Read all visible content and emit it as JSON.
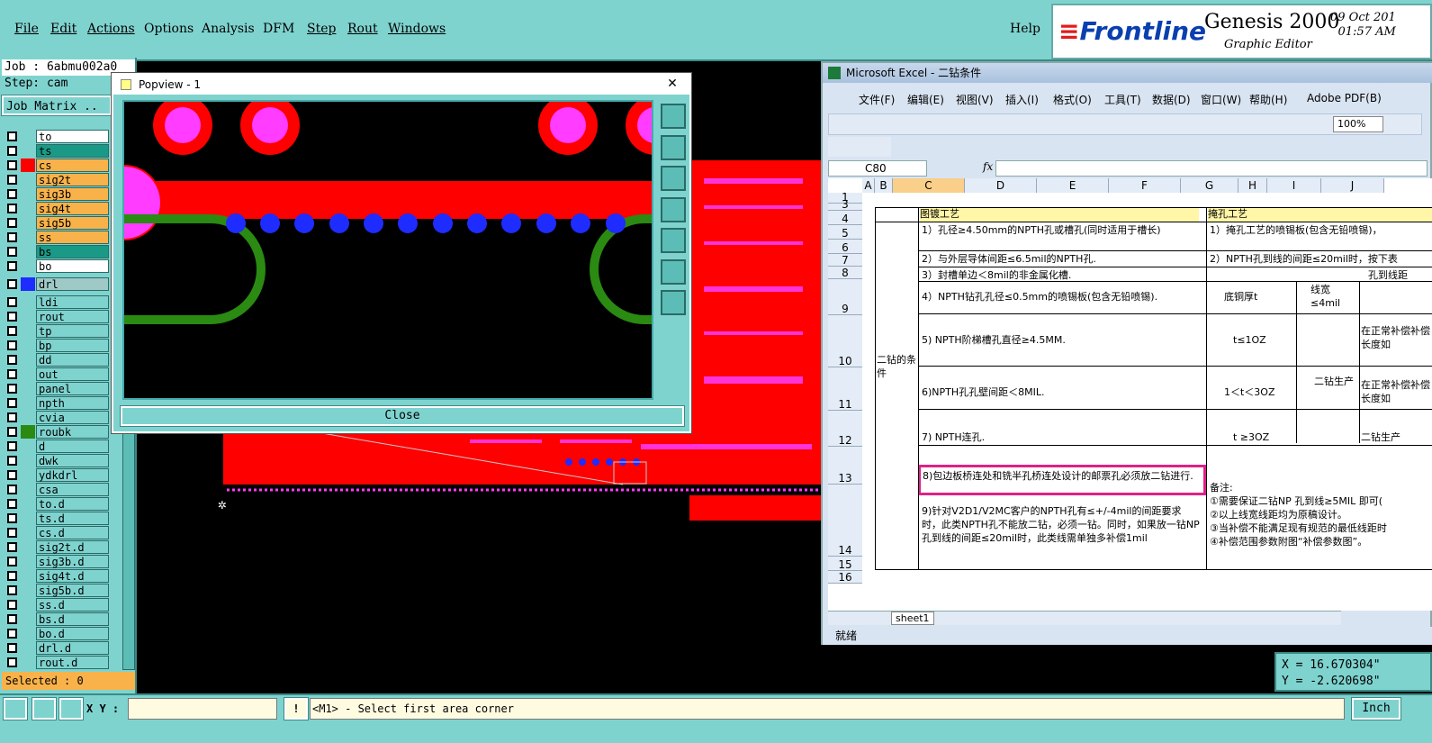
{
  "menubar": {
    "items": [
      "File",
      "Edit",
      "Actions",
      "Options",
      "Analysis",
      "DFM",
      "Step",
      "Rout",
      "Windows"
    ],
    "help": "Help"
  },
  "brand": {
    "logo": "Frontline",
    "product": "Genesis 2000",
    "subtitle": "Graphic Editor",
    "date": "09 Oct 201",
    "time": "01:57 AM"
  },
  "left": {
    "job": "Job : 6abmu002a0",
    "step": "Step: cam",
    "matrix": "Job Matrix ..",
    "selected": "Selected : 0",
    "layers": [
      {
        "name": "to",
        "color": "#ffffff"
      },
      {
        "name": "ts",
        "color": "#1a9a86"
      },
      {
        "name": "cs",
        "color": "#f9b24a"
      },
      {
        "name": "sig2t",
        "color": "#f9b24a"
      },
      {
        "name": "sig3b",
        "color": "#f9b24a"
      },
      {
        "name": "sig4t",
        "color": "#f9b24a"
      },
      {
        "name": "sig5b",
        "color": "#f9b24a"
      },
      {
        "name": "ss",
        "color": "#f9b24a"
      },
      {
        "name": "bs",
        "color": "#1a9a86"
      },
      {
        "name": "bo",
        "color": "#ffffff"
      },
      {
        "name": "drl",
        "color": "#9fc9c6"
      },
      {
        "name": "ldi",
        "color": "#7fd3cf"
      },
      {
        "name": "rout",
        "color": "#7fd3cf"
      },
      {
        "name": "tp",
        "color": "#7fd3cf"
      },
      {
        "name": "bp",
        "color": "#7fd3cf"
      },
      {
        "name": "dd",
        "color": "#7fd3cf"
      },
      {
        "name": "out",
        "color": "#7fd3cf"
      },
      {
        "name": "panel",
        "color": "#7fd3cf"
      },
      {
        "name": "npth",
        "color": "#7fd3cf"
      },
      {
        "name": "cvia",
        "color": "#7fd3cf"
      },
      {
        "name": "roubk",
        "color": "#7fd3cf"
      },
      {
        "name": "d",
        "color": "#7fd3cf"
      },
      {
        "name": "dwk",
        "color": "#7fd3cf"
      },
      {
        "name": "ydkdrl",
        "color": "#7fd3cf"
      },
      {
        "name": "csa",
        "color": "#7fd3cf"
      },
      {
        "name": "to.d",
        "color": "#7fd3cf"
      },
      {
        "name": "ts.d",
        "color": "#7fd3cf"
      },
      {
        "name": "cs.d",
        "color": "#7fd3cf"
      },
      {
        "name": "sig2t.d",
        "color": "#7fd3cf"
      },
      {
        "name": "sig3b.d",
        "color": "#7fd3cf"
      },
      {
        "name": "sig4t.d",
        "color": "#7fd3cf"
      },
      {
        "name": "sig5b.d",
        "color": "#7fd3cf"
      },
      {
        "name": "ss.d",
        "color": "#7fd3cf"
      },
      {
        "name": "bs.d",
        "color": "#7fd3cf"
      },
      {
        "name": "bo.d",
        "color": "#7fd3cf"
      },
      {
        "name": "drl.d",
        "color": "#7fd3cf"
      },
      {
        "name": "rout.d",
        "color": "#7fd3cf"
      }
    ]
  },
  "popview": {
    "title": "Popview - 1",
    "close": "Close"
  },
  "excel": {
    "title": "Microsoft Excel - 二钻条件",
    "menu": [
      "文件(F)",
      "编辑(E)",
      "视图(V)",
      "插入(I)",
      "格式(O)",
      "工具(T)",
      "数据(D)",
      "窗口(W)",
      "帮助(H)",
      "Adobe PDF(B)"
    ],
    "zoom": "100%",
    "namebox": "C80",
    "fx": "fx",
    "cols": [
      "A",
      "B",
      "C",
      "D",
      "E",
      "F",
      "G",
      "H",
      "I",
      "J"
    ],
    "rows": [
      "1",
      "3",
      "4",
      "5",
      "6",
      "7",
      "8",
      "9",
      "10",
      "11",
      "12",
      "13",
      "14",
      "15",
      "16"
    ],
    "sheettab": "sheet1",
    "status": "就绪",
    "cells": {
      "c_hdr": "图镀工艺",
      "g_hdr": "掩孔工艺",
      "b_merged": "二钻的条件",
      "c4": "1）孔径≥4.50mm的NPTH孔或槽孔(同时适用于槽长)",
      "g4": "1）掩孔工艺的喷锡板(包含无铅喷锡)，",
      "c6": "2）与外层导体间距≤6.5mil的NPTH孔.",
      "g6": "2）NPTH孔到线的间距≤20mil时，按下表",
      "c8": "3）封槽单边＜8mil的非金属化槽.",
      "g8": "孔到线距",
      "c9": "4）NPTH钻孔孔径≤0.5mm的喷锡板(包含无铅喷锡).",
      "g9": "底铜厚t",
      "h9": "线宽≤4mil",
      "c10": "5) NPTH阶梯槽孔直径≥4.5MM.",
      "g10": "t≤1OZ",
      "j10": "在正常补偿补偿长度如",
      "c11": "6)NPTH孔孔壁间距＜8MIL.",
      "g11": "1＜t＜3OZ",
      "i11": "二钻生产",
      "j11": "在正常补偿补偿长度如",
      "c12": "7) NPTH连孔.",
      "g12": "t ≥3OZ",
      "j12": "二钻生产",
      "c13": "8)包边板桥连处和铣半孔桥连处设计的邮票孔必须放二钻进行.",
      "c14": "9)针对V2D1/V2MC客户的NPTH孔有≤+/-4mil的间距要求时，此类NPTH孔不能放二钻，必须一钻。同时，如果放一钻NP孔到线的间距≤20mil时，此类线需单独多补偿1mil",
      "g13": "备注:\n①需要保证二钻NP 孔到线≥5MIL 即可(\n②以上线宽线距均为原稿设计。\n③当补偿不能满足现有规范的最低线距时\n④补偿范围参数附图“补偿参数图”。"
    }
  },
  "bottombar": {
    "xy_label": "X Y :",
    "xy_value": "",
    "prompt": "<M1> - Select first area corner",
    "unit": "Inch"
  },
  "coords": {
    "x": "X  = 16.670304\"",
    "y": "Y  = -2.620698\""
  },
  "colors": {
    "panel": "#7fd3cf",
    "pcb_red": "#ff0000",
    "pad_magenta": "#ff3cff",
    "via_blue": "#1e2cff",
    "trace_green": "#2a8a12"
  }
}
